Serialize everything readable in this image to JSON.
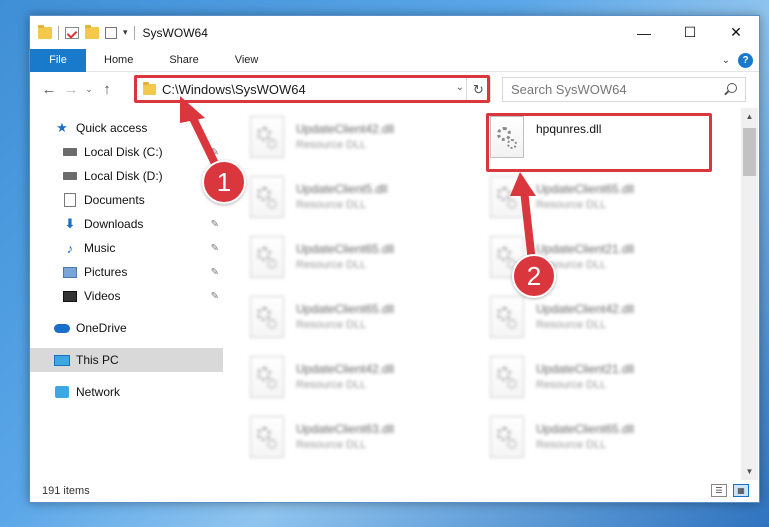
{
  "window": {
    "title": "SysWOW64",
    "controls": {
      "minimize": "—",
      "maximize": "☐",
      "close": "✕"
    }
  },
  "ribbon": {
    "tabs": [
      "File",
      "Home",
      "Share",
      "View"
    ],
    "help": "?"
  },
  "navbar": {
    "back": "←",
    "forward": "→",
    "recent": "⌄",
    "up": "↑",
    "address": "C:\\Windows\\SysWOW64",
    "search_placeholder": "Search SysWOW64"
  },
  "sidebar": {
    "items": [
      {
        "label": "Quick access",
        "icon": "star-icon"
      },
      {
        "label": "Local Disk (C:)",
        "icon": "disk-icon"
      },
      {
        "label": "Local Disk (D:)",
        "icon": "disk-icon"
      },
      {
        "label": "Documents",
        "icon": "documents-icon"
      },
      {
        "label": "Downloads",
        "icon": "downloads-icon"
      },
      {
        "label": "Music",
        "icon": "music-icon"
      },
      {
        "label": "Pictures",
        "icon": "pictures-icon"
      },
      {
        "label": "Videos",
        "icon": "videos-icon"
      },
      {
        "label": "OneDrive",
        "icon": "onedrive-icon"
      },
      {
        "label": "This PC",
        "icon": "this-pc-icon"
      },
      {
        "label": "Network",
        "icon": "network-icon"
      }
    ]
  },
  "files": [
    {
      "name": "UpdateClient42.dll",
      "type": "Resource DLL"
    },
    {
      "name": "hpqunres.dll",
      "type": ""
    },
    {
      "name": "UpdateClient5.dll",
      "type": "Resource DLL"
    },
    {
      "name": "UpdateClient65.dll",
      "type": "Resource DLL"
    },
    {
      "name": "UpdateClient65.dll",
      "type": "Resource DLL"
    },
    {
      "name": "UpdateClient21.dll",
      "type": "Resource DLL"
    },
    {
      "name": "UpdateClient65.dll",
      "type": "Resource DLL"
    },
    {
      "name": "UpdateClient42.dll",
      "type": "Resource DLL"
    },
    {
      "name": "UpdateClient42.dll",
      "type": "Resource DLL"
    },
    {
      "name": "UpdateClient21.dll",
      "type": "Resource DLL"
    },
    {
      "name": "UpdateClient63.dll",
      "type": "Resource DLL"
    },
    {
      "name": "UpdateClient65.dll",
      "type": "Resource DLL"
    }
  ],
  "status": {
    "count": "191 items"
  },
  "annotations": {
    "step1": "1",
    "step2": "2",
    "color": "#d9373d"
  }
}
